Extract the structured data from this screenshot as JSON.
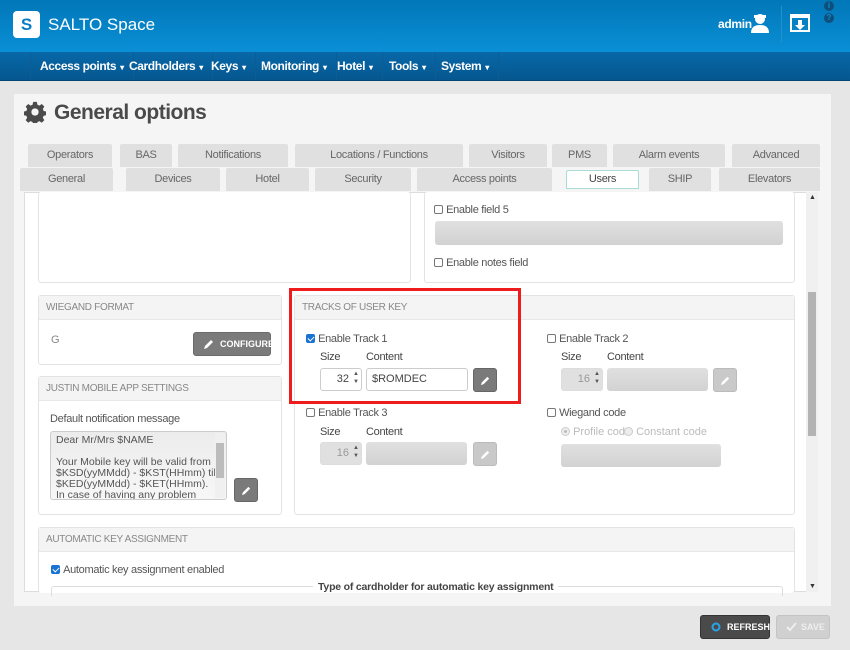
{
  "app": {
    "name": "SALTO Space",
    "logo_letter": "S"
  },
  "header": {
    "user": "admin",
    "icons": [
      "user-icon",
      "download-window-icon",
      "info-icon",
      "help-icon"
    ]
  },
  "nav": [
    {
      "label": "Access points"
    },
    {
      "label": "Cardholders"
    },
    {
      "label": "Keys"
    },
    {
      "label": "Monitoring"
    },
    {
      "label": "Hotel"
    },
    {
      "label": "Tools"
    },
    {
      "label": "System"
    }
  ],
  "page": {
    "title": "General options"
  },
  "tabs_row1": [
    {
      "label": "Operators"
    },
    {
      "label": "BAS"
    },
    {
      "label": "Notifications"
    },
    {
      "label": "Locations / Functions"
    },
    {
      "label": "Visitors"
    },
    {
      "label": "PMS"
    },
    {
      "label": "Alarm events"
    },
    {
      "label": "Advanced"
    }
  ],
  "tabs_row2": [
    {
      "label": "General"
    },
    {
      "label": "Devices"
    },
    {
      "label": "Hotel"
    },
    {
      "label": "Security"
    },
    {
      "label": "Access points"
    },
    {
      "label": "Users",
      "active": true
    },
    {
      "label": "SHIP"
    },
    {
      "label": "Elevators"
    }
  ],
  "fields": {
    "enable_field5": {
      "label": "Enable field 5",
      "checked": false,
      "value": ""
    },
    "enable_notes": {
      "label": "Enable notes field",
      "checked": false
    }
  },
  "wiegand_format": {
    "title": "WIEGAND FORMAT",
    "value": "G",
    "configure_label": "CONFIGURE"
  },
  "justin": {
    "title": "JUSTIN MOBILE APP SETTINGS",
    "message_label": "Default notification message",
    "message_lines": [
      "Dear Mr/Mrs $NAME",
      "",
      "Your Mobile key will be valid from",
      "$KSD(yyMMdd) - $KST(HHmm) till",
      "$KED(yyMMdd) - $KET(HHmm).",
      "In case of having any problem please do"
    ]
  },
  "tracks": {
    "title": "TRACKS OF USER KEY",
    "size_label": "Size",
    "content_label": "Content",
    "track1": {
      "label": "Enable Track 1",
      "checked": true,
      "size": "32",
      "content": "$ROMDEC"
    },
    "track2": {
      "label": "Enable Track 2",
      "checked": false,
      "size": "16",
      "content": ""
    },
    "track3": {
      "label": "Enable Track 3",
      "checked": false,
      "size": "16",
      "content": ""
    },
    "wiegand_code": {
      "label": "Wiegand code",
      "checked": false,
      "options": [
        "Profile code",
        "Constant code"
      ],
      "selected": "Profile code"
    }
  },
  "auto_key": {
    "title": "AUTOMATIC KEY ASSIGNMENT",
    "enabled_label": "Automatic key assignment enabled",
    "enabled": true,
    "fieldset_legend": "Type of cardholder for automatic key assignment"
  },
  "footer": {
    "refresh_label": "REFRESH",
    "save_label": "SAVE"
  },
  "colors": {
    "brand": "#0a8fd6",
    "nav": "#05578f",
    "highlight": "#ee1c1c",
    "checkbox": "#1a73d0"
  }
}
